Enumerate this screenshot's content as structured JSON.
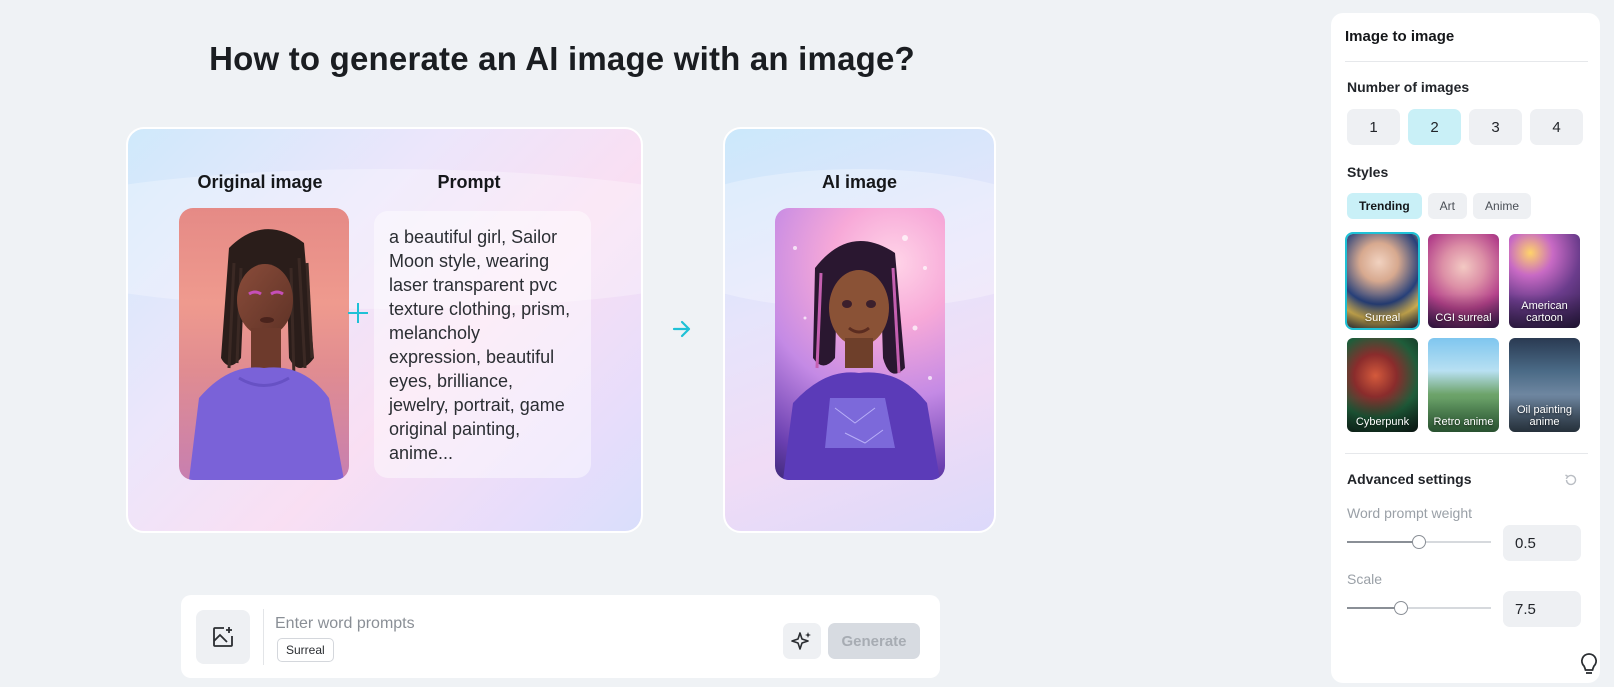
{
  "heading": "How to generate an AI image with an image?",
  "demo": {
    "original_label": "Original image",
    "prompt_label": "Prompt",
    "prompt_text": "a beautiful girl, Sailor Moon style, wearing laser transparent pvc texture clothing, prism, melancholy expression, beautiful eyes, brilliance, jewelry, portrait, game original painting, anime...",
    "ai_label": "AI image"
  },
  "prompt_bar": {
    "placeholder": "Enter word prompts",
    "style_chip": "Surreal",
    "generate_label": "Generate"
  },
  "panel": {
    "title": "Image to image",
    "number_of_images_label": "Number of images",
    "number_options": [
      "1",
      "2",
      "3",
      "4"
    ],
    "number_selected": "2",
    "styles_label": "Styles",
    "style_tabs": [
      "Trending",
      "Art",
      "Anime"
    ],
    "style_tab_selected": "Trending",
    "styles": [
      "Surreal",
      "CGI surreal",
      "American cartoon",
      "Cyberpunk",
      "Retro anime",
      "Oil painting anime"
    ],
    "style_selected": "Surreal",
    "advanced_label": "Advanced settings",
    "word_prompt_weight_label": "Word prompt weight",
    "word_prompt_weight": "0.5",
    "word_prompt_weight_fraction": 0.5,
    "scale_label": "Scale",
    "scale": "7.5",
    "scale_fraction": 0.375
  },
  "colors": {
    "accent": "#1fc1d6",
    "selected_bg": "#c9f0f7",
    "page_bg": "#eff2f5"
  }
}
